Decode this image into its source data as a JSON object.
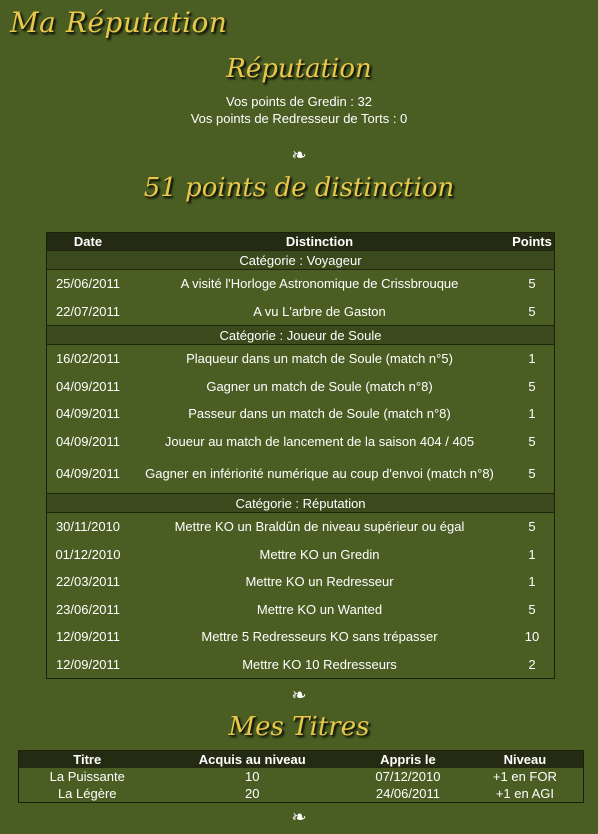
{
  "page_title": "Ma Réputation",
  "reputation": {
    "title": "Réputation",
    "gredin": "Vos points de Gredin : 32",
    "redresseur": "Vos points de Redresseur de Torts : 0"
  },
  "fleuron": "❧",
  "distinction": {
    "title": "51 points de distinction",
    "headers": {
      "date": "Date",
      "distinction": "Distinction",
      "points": "Points"
    },
    "categories": [
      {
        "label": "Catégorie : Voyageur",
        "rows": [
          {
            "date": "25/06/2011",
            "text": "A visité l'Horloge Astronomique de Crissbrouque",
            "points": "5"
          },
          {
            "date": "22/07/2011",
            "text": "A vu L'arbre de Gaston",
            "points": "5"
          }
        ]
      },
      {
        "label": "Catégorie : Joueur de Soule",
        "rows": [
          {
            "date": "16/02/2011",
            "text": "Plaqueur dans un match de Soule (match n°5)",
            "points": "1"
          },
          {
            "date": "04/09/2011",
            "text": "Gagner un match de Soule (match n°8)",
            "points": "5"
          },
          {
            "date": "04/09/2011",
            "text": "Passeur dans un match de Soule (match n°8)",
            "points": "1"
          },
          {
            "date": "04/09/2011",
            "text": "Joueur au match de lancement de la saison 404 / 405",
            "points": "5"
          },
          {
            "date": "04/09/2011",
            "text": "Gagner en infériorité numérique au coup d'envoi (match n°8)",
            "points": "5"
          }
        ]
      },
      {
        "label": "Catégorie : Réputation",
        "rows": [
          {
            "date": "30/11/2010",
            "text": "Mettre KO un Braldûn de niveau supérieur ou égal",
            "points": "5"
          },
          {
            "date": "01/12/2010",
            "text": "Mettre KO un Gredin",
            "points": "1"
          },
          {
            "date": "22/03/2011",
            "text": "Mettre KO un Redresseur",
            "points": "1"
          },
          {
            "date": "23/06/2011",
            "text": "Mettre KO un Wanted",
            "points": "5"
          },
          {
            "date": "12/09/2011",
            "text": "Mettre 5 Redresseurs KO sans trépasser",
            "points": "10"
          },
          {
            "date": "12/09/2011",
            "text": "Mettre KO 10 Redresseurs",
            "points": "2"
          }
        ]
      }
    ]
  },
  "titres": {
    "title": "Mes Titres",
    "headers": {
      "titre": "Titre",
      "acquis": "Acquis au niveau",
      "appris": "Appris le",
      "niveau": "Niveau"
    },
    "rows": [
      {
        "titre": "La Puissante",
        "acquis": "10",
        "appris": "07/12/2010",
        "niveau": "+1 en FOR"
      },
      {
        "titre": "La Légère",
        "acquis": "20",
        "appris": "24/06/2011",
        "niveau": "+1 en AGI"
      }
    ]
  }
}
